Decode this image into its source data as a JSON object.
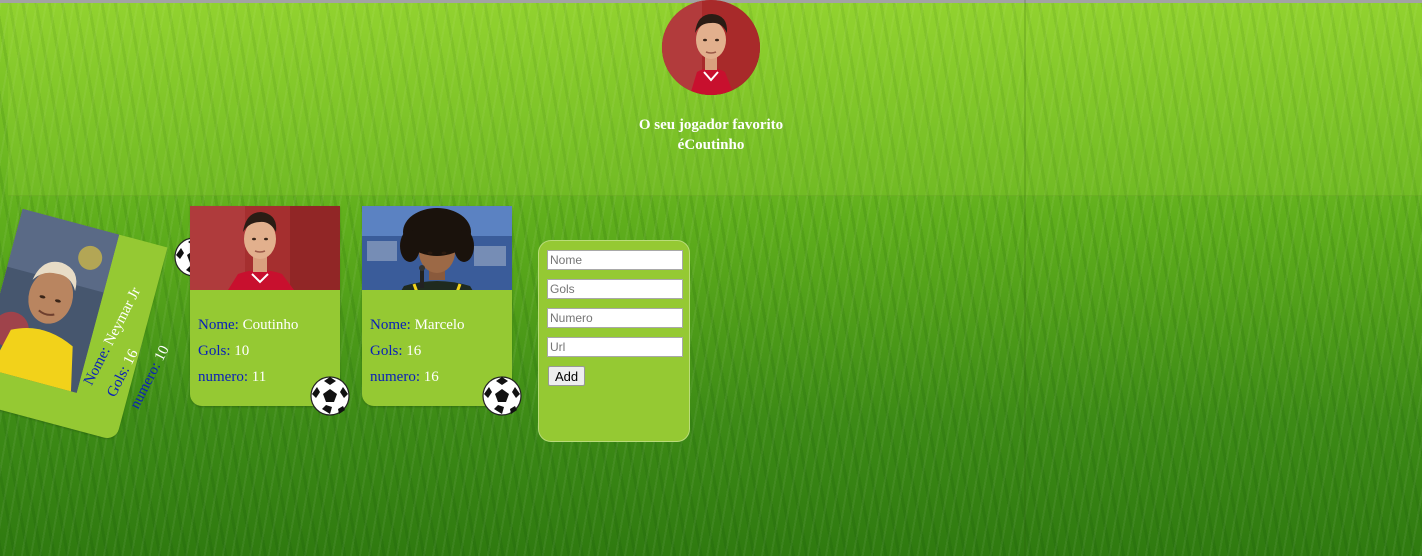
{
  "favorite": {
    "line1": "O seu jogador favorito",
    "line2": "éCoutinho"
  },
  "players": [
    {
      "name_label": "Nome: ",
      "name": "Neymar Jr",
      "gols_label": "Gols: ",
      "gols": "16",
      "numero_label": "numero: ",
      "numero": "10"
    },
    {
      "name_label": "Nome: ",
      "name": "Coutinho",
      "gols_label": "Gols: ",
      "gols": "10",
      "numero_label": "numero: ",
      "numero": "11"
    },
    {
      "name_label": "Nome: ",
      "name": "Marcelo",
      "gols_label": "Gols: ",
      "gols": "16",
      "numero_label": "numero: ",
      "numero": "16"
    }
  ],
  "form": {
    "nome_placeholder": "Nome",
    "gols_placeholder": "Gols",
    "numero_placeholder": "Numero",
    "url_placeholder": "Url",
    "add_label": "Add"
  },
  "colors": {
    "card_bg": "#95c933",
    "label_blue": "#0a20b8"
  }
}
